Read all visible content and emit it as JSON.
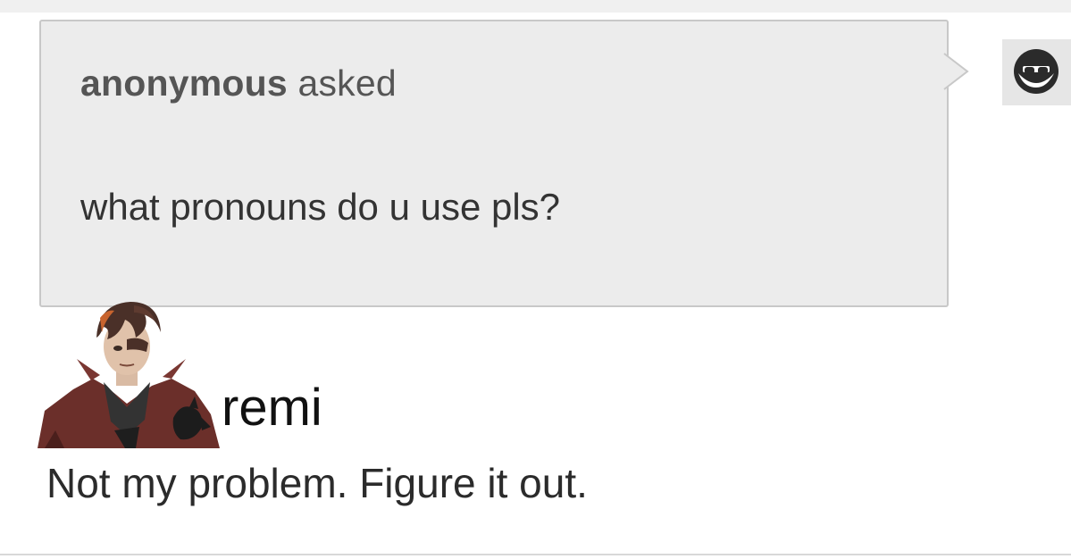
{
  "ask": {
    "asker_name": "anonymous",
    "asked_label": "asked",
    "question": "what pronouns do u use pls?",
    "asker_avatar_icon": "sunglasses-face-icon"
  },
  "answer": {
    "username": "remi",
    "avatar_icon": "character-portrait",
    "text": "Not my problem. Figure it out."
  },
  "colors": {
    "ask_background": "#ececec",
    "ask_border": "#c8c8c8",
    "asker_text": "#555555",
    "question_text": "#333333",
    "answer_text": "#2b2b2b"
  }
}
